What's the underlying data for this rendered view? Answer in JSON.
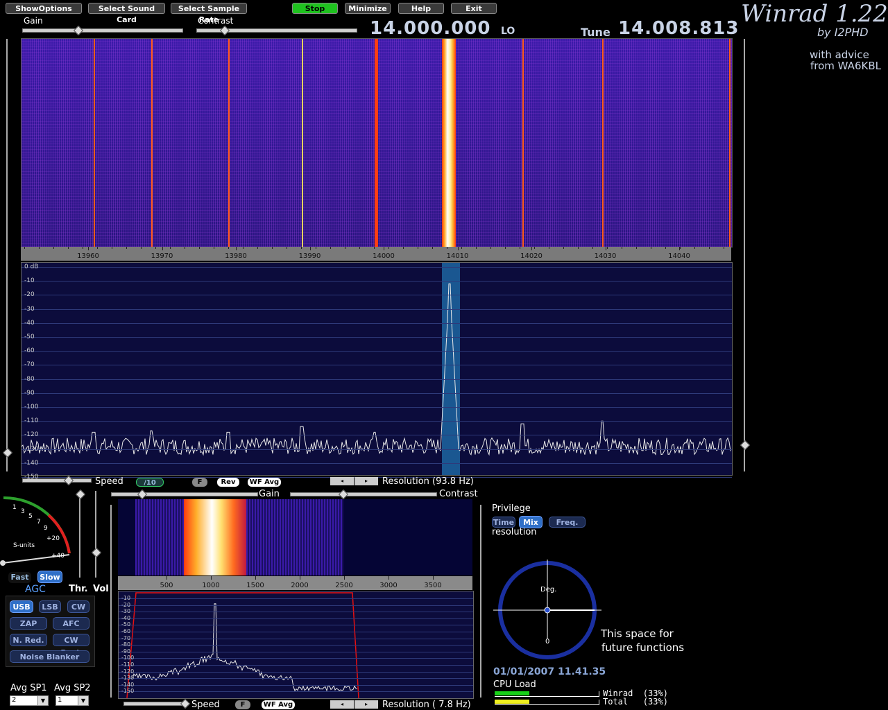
{
  "toolbar": {
    "show_options": "ShowOptions",
    "select_sound_card": "Select Sound Card",
    "select_sample_rate": "Select Sample Rate",
    "stop": "Stop",
    "minimize": "Minimize",
    "help": "Help",
    "exit": "Exit"
  },
  "header": {
    "gain_label": "Gain",
    "contrast_label": "Contrast",
    "lo_freq": "14.000.000",
    "lo_label": "LO",
    "tune_label": "Tune",
    "tune_freq": "14.008.813",
    "brand_title": "Winrad 1.22",
    "brand_by": "by I2PHD",
    "advice_line1": "with advice",
    "advice_line2": "from WA6KBL"
  },
  "main_axis": {
    "ticks": [
      "13960",
      "13970",
      "13980",
      "13990",
      "14000",
      "14010",
      "14020",
      "14030",
      "14040"
    ]
  },
  "spectrum": {
    "db_labels": [
      "0 dB",
      "-10",
      "-20",
      "-30",
      "-40",
      "-50",
      "-60",
      "-70",
      "-80",
      "-90",
      "-100",
      "-110",
      "-120",
      "-130",
      "-140",
      "-150"
    ]
  },
  "main_controls": {
    "speed_label": "Speed",
    "div10": "/10",
    "f_btn": "F",
    "rev_btn": "Rev",
    "wfavg_btn": "WF Avg",
    "resolution": "Resolution (93.8 Hz)"
  },
  "audio_controls": {
    "gain_label": "Gain",
    "contrast_label": "Contrast",
    "speed_label": "Speed",
    "f_btn": "F",
    "wfavg_btn": "WF Avg",
    "resolution": "Resolution ( 7.8 Hz)"
  },
  "audio_axis": {
    "ticks": [
      "500",
      "1000",
      "1500",
      "2000",
      "2500",
      "3000",
      "3500"
    ]
  },
  "audio_spec": {
    "db_labels": [
      "-10",
      "-20",
      "-30",
      "-40",
      "-50",
      "-60",
      "-70",
      "-80",
      "-90",
      "-100",
      "-110",
      "-120",
      "-130",
      "-140",
      "-150"
    ]
  },
  "smeter": {
    "label": "S-units",
    "scale": [
      "1",
      "3",
      "5",
      "7",
      "9",
      "+20",
      "+40"
    ]
  },
  "agc": {
    "fast": "Fast",
    "slow": "Slow",
    "label": "AGC",
    "thr": "Thr.",
    "vol": "Vol"
  },
  "modes": {
    "usb": "USB",
    "lsb": "LSB",
    "cw": "CW",
    "zap": "ZAP",
    "afc": "AFC",
    "nred": "N. Red.",
    "cwpeak": "CW Peak",
    "noise_blanker": "Noise Blanker"
  },
  "avg": {
    "sp1_label": "Avg SP1",
    "sp2_label": "Avg SP2",
    "sp1_value": "2",
    "sp2_value": "1"
  },
  "privilege": {
    "label": "Privilege",
    "time": "Time",
    "mix": "Mix",
    "freq": "Freq.",
    "resolution": "resolution"
  },
  "dial": {
    "deg": "Deg.",
    "zero": "0"
  },
  "future": {
    "line1": "This space for",
    "line2": "future functions"
  },
  "status": {
    "datetime": "01/01/2007 11.41.35",
    "cpu_label": "CPU Load",
    "winrad": "Winrad  (33%)",
    "total": "Total   (33%)",
    "winrad_load": 0.33,
    "total_load": 0.33
  },
  "colors": {
    "accent_green": "#1fc21f",
    "carrier": "#ffffff",
    "signal_line": "#ff5a1a",
    "filter_red": "#e81010"
  }
}
